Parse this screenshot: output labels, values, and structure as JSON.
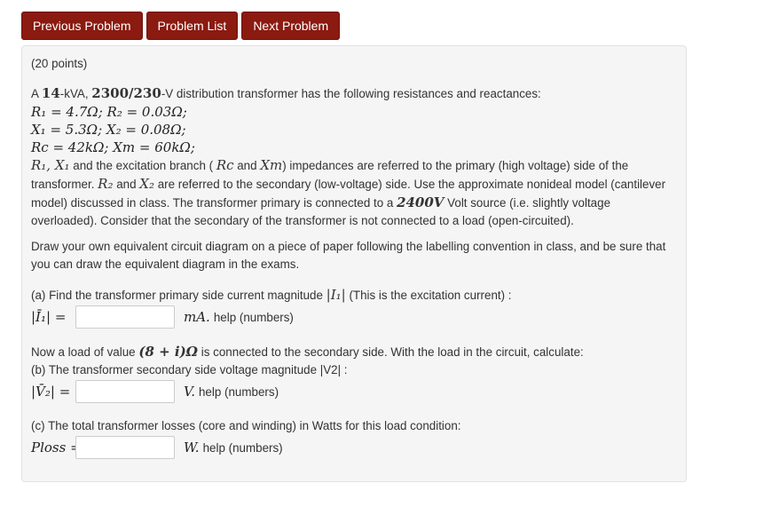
{
  "nav": {
    "previous": "Previous Problem",
    "list": "Problem List",
    "next": "Next Problem",
    "button_color": "#8b1a10"
  },
  "problem": {
    "points": "(20 points)",
    "intro_a": "A ",
    "kva": "14",
    "intro_b": "-kVA, ",
    "voltage": "2300/230",
    "intro_c": "-V distribution transformer has the following resistances and reactances:",
    "line1": "R₁ = 4.7Ω; R₂ = 0.03Ω;",
    "line2": "X₁ = 5.3Ω; X₂ = 0.08Ω;",
    "line3": "Rc = 42kΩ; Xm = 60kΩ;",
    "para1_math1": "R₁, X₁",
    "para1_a": " and the excitation branch ( ",
    "para1_math2": "Rc",
    "para1_b": " and ",
    "para1_math3": "Xm",
    "para1_c": ") impedances are referred to the primary (high voltage) side of the transformer. ",
    "para1_math4": "R₂",
    "para1_d": " and ",
    "para1_math5": "X₂",
    "para1_e": " are referred to the secondary (low-voltage) side. Use the approximate nonideal model (cantilever model) discussed in class. The transformer primary is connected to a ",
    "para1_math6": "2400V",
    "para1_f": " Volt source (i.e. slightly voltage overloaded). Consider that the secondary of the transformer is not connected to a load (open-circuited).",
    "para2": "Draw your own equivalent circuit diagram on a piece of paper following the labelling convention in class, and be sure that you can draw the equivalent diagram in the exams.",
    "part_a_a": "(a) Find the transformer primary side current magnitude ",
    "part_a_math": "|I₁|",
    "part_a_b": " (This is the excitation current) :",
    "part_a_label": "|Ī₁| =",
    "part_a_unit": "mA.",
    "load_a": "Now a load of value ",
    "load_math": "(8 + i)Ω",
    "load_b": " is connected to the secondary side. With the load in the circuit, calculate:",
    "part_b": "(b) The transformer secondary side voltage magnitude |V2| :",
    "part_b_label": "|V̄₂| =",
    "part_b_unit": "V.",
    "part_c": "(c) The total transformer losses (core and winding) in Watts for this load condition:",
    "part_c_label": "Ploss =",
    "part_c_unit": "W.",
    "help": "help (numbers)",
    "input_value": ""
  }
}
